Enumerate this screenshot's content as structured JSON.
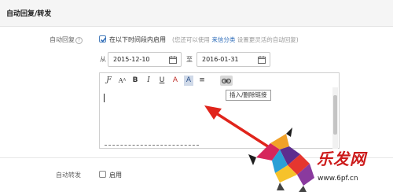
{
  "section": {
    "title": "自动回复/转发"
  },
  "auto_reply": {
    "label": "自动回复",
    "help": "?",
    "checked": true,
    "checkbox_label": "在以下时间段内启用",
    "hint_prefix": "(您还可以使用",
    "hint_link": "来信分类",
    "hint_suffix": "设置更灵活的自动回复)",
    "from_label": "从",
    "start_date": "2015-12-10",
    "to_label": "至",
    "end_date": "2016-01-31"
  },
  "toolbar": {
    "buttons": [
      {
        "icon": "font-family-icon",
        "glyph": "Ƒ"
      },
      {
        "icon": "font-size-icon",
        "glyph": "Aᴬ"
      },
      {
        "icon": "bold-icon",
        "glyph": "B"
      },
      {
        "icon": "italic-icon",
        "glyph": "I"
      },
      {
        "icon": "underline-icon",
        "glyph": "U"
      },
      {
        "icon": "font-color-icon",
        "glyph": "A"
      },
      {
        "icon": "background-color-icon",
        "glyph": "A"
      },
      {
        "icon": "align-icon",
        "glyph": "≡"
      },
      {
        "icon": "link-icon",
        "glyph": "⊖"
      }
    ],
    "tooltip": "插入/删除链接"
  },
  "auto_forward": {
    "label": "自动转发",
    "checked": false,
    "checkbox_label": "启用"
  },
  "watermark": {
    "text": "乐发网",
    "url": "www.6pf.cn"
  },
  "colors": {
    "link": "#2a6ab8",
    "accent_red": "#cc1a1a",
    "arrow": "#e0241b"
  }
}
